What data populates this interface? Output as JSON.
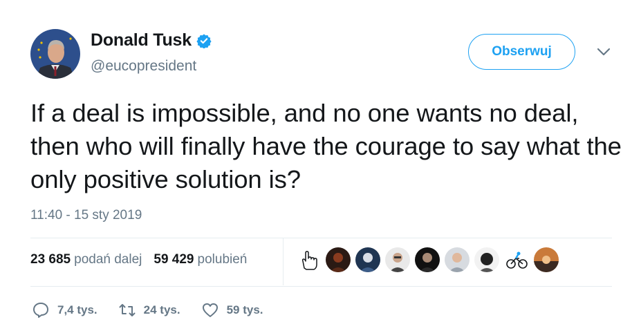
{
  "author": {
    "name": "Donald Tusk",
    "handle": "@eucopresident",
    "verified_icon": "verified-badge-icon"
  },
  "follow_label": "Obserwuj",
  "tweet": {
    "text": "If a deal is impossible, and no one wants no deal, then who will finally have the courage to say what the only positive solution is?",
    "timestamp": "11:40 - 15 sty 2019"
  },
  "stats": {
    "retweets_count": "23 685",
    "retweets_label": "podań dalej",
    "likes_count": "59 429",
    "likes_label": "polubień"
  },
  "actions": {
    "reply_count": "7,4 tys.",
    "retweet_count": "24 tys.",
    "like_count": "59 tys."
  },
  "colors": {
    "accent": "#1da1f2",
    "secondary_text": "#657786",
    "primary_text": "#14171a",
    "divider": "#e6ecf0"
  }
}
